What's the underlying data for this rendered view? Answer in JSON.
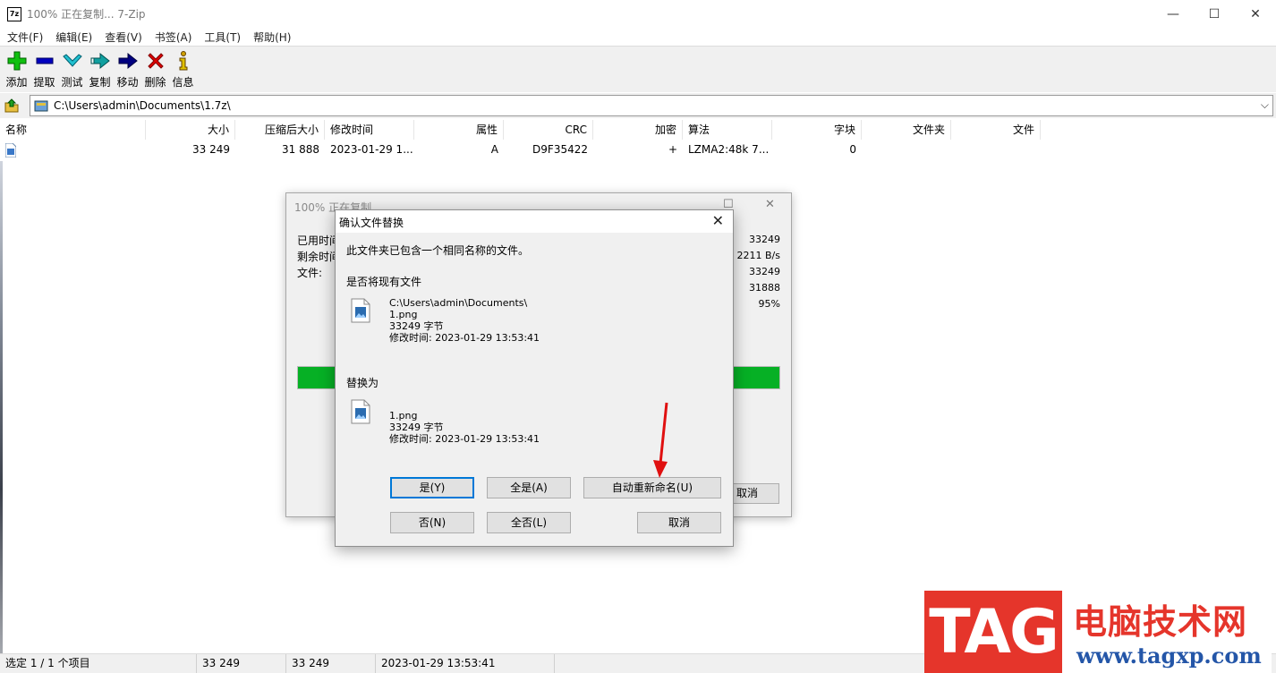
{
  "window": {
    "app_icon_text": "7z",
    "title": "100% 正在复制... 7-Zip",
    "minimize": "—",
    "maximize": "☐",
    "close": "✕"
  },
  "menu": [
    "文件(F)",
    "编辑(E)",
    "查看(V)",
    "书签(A)",
    "工具(T)",
    "帮助(H)"
  ],
  "toolbar": [
    {
      "label": "添加",
      "icon": "add-icon",
      "color": "#10c010"
    },
    {
      "label": "提取",
      "icon": "extract-icon",
      "color": "#0000c0"
    },
    {
      "label": "测试",
      "icon": "test-icon",
      "color": "#20b0c0"
    },
    {
      "label": "复制",
      "icon": "copy-icon",
      "color": "#109090"
    },
    {
      "label": "移动",
      "icon": "move-icon",
      "color": "#000080"
    },
    {
      "label": "删除",
      "icon": "delete-icon",
      "color": "#e00000"
    },
    {
      "label": "信息",
      "icon": "info-icon",
      "color": "#d0a000"
    }
  ],
  "address": {
    "path": "C:\\Users\\admin\\Documents\\1.7z\\"
  },
  "columns": [
    "名称",
    "大小",
    "压缩后大小",
    "修改时间",
    "属性",
    "CRC",
    "加密",
    "算法",
    "字块",
    "文件夹",
    "文件"
  ],
  "rows": [
    {
      "name": "",
      "size": "33 249",
      "packed": "31 888",
      "modified": "2023-01-29 1...",
      "attr": "A",
      "crc": "D9F35422",
      "encrypted": "+",
      "method": "LZMA2:48k 7...",
      "block": "0",
      "folders": "",
      "files": ""
    }
  ],
  "status": {
    "selected": "选定 1 / 1 个项目",
    "size": "33 249",
    "packed": "33 249",
    "modified": "2023-01-29 13:53:41"
  },
  "progress_window": {
    "title": "100% 正在复制",
    "labels": [
      "已用时间",
      "剩余时间",
      "文件:"
    ],
    "values": [
      "33249",
      "2211 B/s",
      "33249",
      "31888",
      "95%"
    ],
    "progress_percent": 100,
    "cancel_label": "取消"
  },
  "dialog": {
    "title": "确认文件替换",
    "message": "此文件夹已包含一个相同名称的文件。",
    "existing_heading": "是否将现有文件",
    "existing": {
      "path": "C:\\Users\\admin\\Documents\\",
      "name": "1.png",
      "size": "33249 字节",
      "modified": "修改时间: 2023-01-29 13:53:41"
    },
    "replace_heading": "替换为",
    "replacement": {
      "name": "1.png",
      "size": "33249 字节",
      "modified": "修改时间: 2023-01-29 13:53:41"
    },
    "buttons": {
      "yes": "是(Y)",
      "yes_all": "全是(A)",
      "auto_rename": "自动重新命名(U)",
      "no": "否(N)",
      "no_all": "全否(L)",
      "cancel": "取消"
    }
  },
  "watermark": {
    "logo": "TAG",
    "cn": "电脑技术网",
    "url": "www.tagxp.com"
  }
}
